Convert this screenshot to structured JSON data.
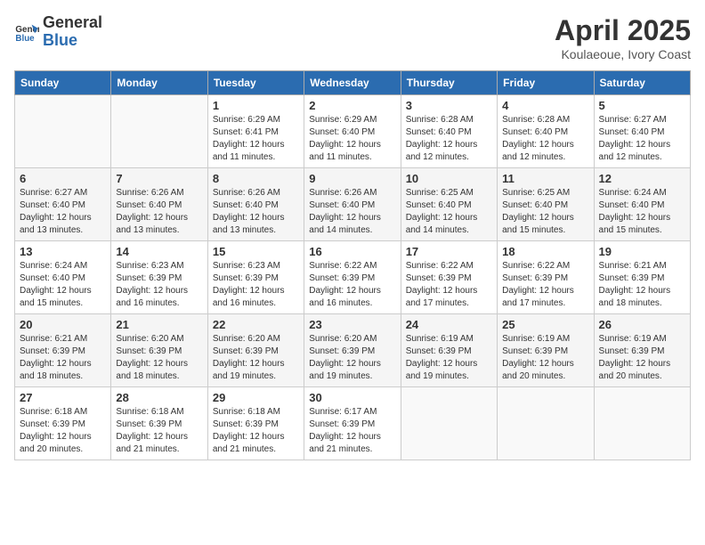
{
  "header": {
    "logo_general": "General",
    "logo_blue": "Blue",
    "title": "April 2025",
    "subtitle": "Koulaeoue, Ivory Coast"
  },
  "calendar": {
    "days_of_week": [
      "Sunday",
      "Monday",
      "Tuesday",
      "Wednesday",
      "Thursday",
      "Friday",
      "Saturday"
    ],
    "weeks": [
      [
        {
          "day": "",
          "info": ""
        },
        {
          "day": "",
          "info": ""
        },
        {
          "day": "1",
          "info": "Sunrise: 6:29 AM\nSunset: 6:41 PM\nDaylight: 12 hours and 11 minutes."
        },
        {
          "day": "2",
          "info": "Sunrise: 6:29 AM\nSunset: 6:40 PM\nDaylight: 12 hours and 11 minutes."
        },
        {
          "day": "3",
          "info": "Sunrise: 6:28 AM\nSunset: 6:40 PM\nDaylight: 12 hours and 12 minutes."
        },
        {
          "day": "4",
          "info": "Sunrise: 6:28 AM\nSunset: 6:40 PM\nDaylight: 12 hours and 12 minutes."
        },
        {
          "day": "5",
          "info": "Sunrise: 6:27 AM\nSunset: 6:40 PM\nDaylight: 12 hours and 12 minutes."
        }
      ],
      [
        {
          "day": "6",
          "info": "Sunrise: 6:27 AM\nSunset: 6:40 PM\nDaylight: 12 hours and 13 minutes."
        },
        {
          "day": "7",
          "info": "Sunrise: 6:26 AM\nSunset: 6:40 PM\nDaylight: 12 hours and 13 minutes."
        },
        {
          "day": "8",
          "info": "Sunrise: 6:26 AM\nSunset: 6:40 PM\nDaylight: 12 hours and 13 minutes."
        },
        {
          "day": "9",
          "info": "Sunrise: 6:26 AM\nSunset: 6:40 PM\nDaylight: 12 hours and 14 minutes."
        },
        {
          "day": "10",
          "info": "Sunrise: 6:25 AM\nSunset: 6:40 PM\nDaylight: 12 hours and 14 minutes."
        },
        {
          "day": "11",
          "info": "Sunrise: 6:25 AM\nSunset: 6:40 PM\nDaylight: 12 hours and 15 minutes."
        },
        {
          "day": "12",
          "info": "Sunrise: 6:24 AM\nSunset: 6:40 PM\nDaylight: 12 hours and 15 minutes."
        }
      ],
      [
        {
          "day": "13",
          "info": "Sunrise: 6:24 AM\nSunset: 6:40 PM\nDaylight: 12 hours and 15 minutes."
        },
        {
          "day": "14",
          "info": "Sunrise: 6:23 AM\nSunset: 6:39 PM\nDaylight: 12 hours and 16 minutes."
        },
        {
          "day": "15",
          "info": "Sunrise: 6:23 AM\nSunset: 6:39 PM\nDaylight: 12 hours and 16 minutes."
        },
        {
          "day": "16",
          "info": "Sunrise: 6:22 AM\nSunset: 6:39 PM\nDaylight: 12 hours and 16 minutes."
        },
        {
          "day": "17",
          "info": "Sunrise: 6:22 AM\nSunset: 6:39 PM\nDaylight: 12 hours and 17 minutes."
        },
        {
          "day": "18",
          "info": "Sunrise: 6:22 AM\nSunset: 6:39 PM\nDaylight: 12 hours and 17 minutes."
        },
        {
          "day": "19",
          "info": "Sunrise: 6:21 AM\nSunset: 6:39 PM\nDaylight: 12 hours and 18 minutes."
        }
      ],
      [
        {
          "day": "20",
          "info": "Sunrise: 6:21 AM\nSunset: 6:39 PM\nDaylight: 12 hours and 18 minutes."
        },
        {
          "day": "21",
          "info": "Sunrise: 6:20 AM\nSunset: 6:39 PM\nDaylight: 12 hours and 18 minutes."
        },
        {
          "day": "22",
          "info": "Sunrise: 6:20 AM\nSunset: 6:39 PM\nDaylight: 12 hours and 19 minutes."
        },
        {
          "day": "23",
          "info": "Sunrise: 6:20 AM\nSunset: 6:39 PM\nDaylight: 12 hours and 19 minutes."
        },
        {
          "day": "24",
          "info": "Sunrise: 6:19 AM\nSunset: 6:39 PM\nDaylight: 12 hours and 19 minutes."
        },
        {
          "day": "25",
          "info": "Sunrise: 6:19 AM\nSunset: 6:39 PM\nDaylight: 12 hours and 20 minutes."
        },
        {
          "day": "26",
          "info": "Sunrise: 6:19 AM\nSunset: 6:39 PM\nDaylight: 12 hours and 20 minutes."
        }
      ],
      [
        {
          "day": "27",
          "info": "Sunrise: 6:18 AM\nSunset: 6:39 PM\nDaylight: 12 hours and 20 minutes."
        },
        {
          "day": "28",
          "info": "Sunrise: 6:18 AM\nSunset: 6:39 PM\nDaylight: 12 hours and 21 minutes."
        },
        {
          "day": "29",
          "info": "Sunrise: 6:18 AM\nSunset: 6:39 PM\nDaylight: 12 hours and 21 minutes."
        },
        {
          "day": "30",
          "info": "Sunrise: 6:17 AM\nSunset: 6:39 PM\nDaylight: 12 hours and 21 minutes."
        },
        {
          "day": "",
          "info": ""
        },
        {
          "day": "",
          "info": ""
        },
        {
          "day": "",
          "info": ""
        }
      ]
    ]
  }
}
